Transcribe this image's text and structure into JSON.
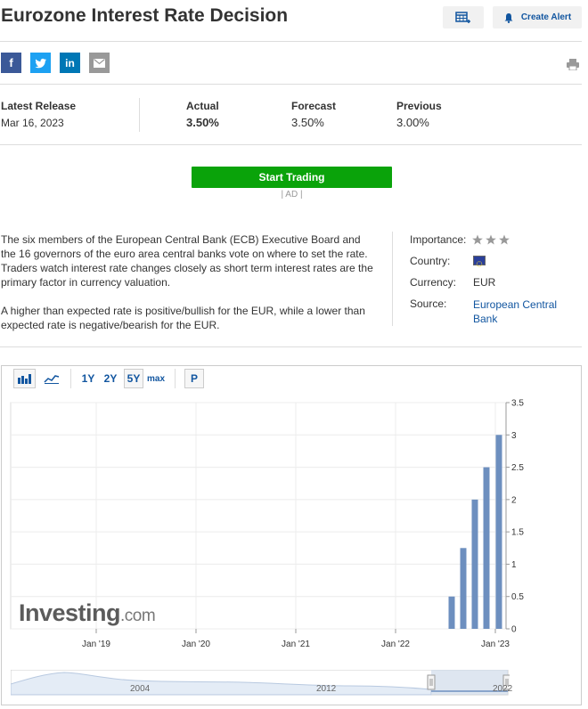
{
  "header": {
    "title": "Eurozone Interest Rate Decision",
    "create_alert_label": "Create Alert"
  },
  "share": {
    "facebook": "f",
    "twitter_icon": "twitter-icon",
    "linkedin": "in",
    "email_icon": "email-icon"
  },
  "release": {
    "latest_label": "Latest Release",
    "latest_date": "Mar 16, 2023",
    "actual_label": "Actual",
    "actual_value": "3.50%",
    "forecast_label": "Forecast",
    "forecast_value": "3.50%",
    "previous_label": "Previous",
    "previous_value": "3.00%"
  },
  "trade": {
    "button_label": "Start Trading",
    "ad_label": "| AD |"
  },
  "description": {
    "p1": "The six members of the European Central Bank (ECB) Executive Board and the 16 governors of the euro area central banks vote on where to set the rate. Traders watch interest rate changes closely as short term interest rates are the primary factor in currency valuation.",
    "p2": "A higher than expected rate is positive/bullish for the EUR, while a lower than expected rate is negative/bearish for the EUR."
  },
  "info": {
    "importance_label": "Importance:",
    "importance_stars": 3,
    "country_label": "Country:",
    "currency_label": "Currency:",
    "currency_value": "EUR",
    "source_label": "Source:",
    "source_line1": "European Central",
    "source_line2": "Bank"
  },
  "chart_controls": {
    "bar_icon": "bar-chart-icon",
    "line_icon": "line-chart-icon",
    "range_1y": "1Y",
    "range_2y": "2Y",
    "range_5y": "5Y",
    "range_max": "max",
    "selected_range": "5Y",
    "p_label": "P"
  },
  "watermark": {
    "brand": "Investing",
    "suffix": ".com"
  },
  "navigator": {
    "labels": [
      "2004",
      "2012",
      "2022"
    ]
  },
  "chart_data": {
    "type": "bar",
    "x_tick_labels": [
      "Jan '19",
      "Jan '20",
      "Jan '21",
      "Jan '22",
      "Jan '23"
    ],
    "y_tick_labels": [
      "0",
      "0.5",
      "1",
      "1.5",
      "2",
      "2.5",
      "3",
      "3.5"
    ],
    "ylim": [
      0,
      3.5
    ],
    "categories": [
      "Jul '22",
      "Sep '22",
      "Oct '22",
      "Dec '22",
      "Feb '23"
    ],
    "values": [
      0.5,
      1.25,
      2.0,
      2.5,
      3.0
    ],
    "bar_color": "#6d8fbf",
    "grid": true
  }
}
